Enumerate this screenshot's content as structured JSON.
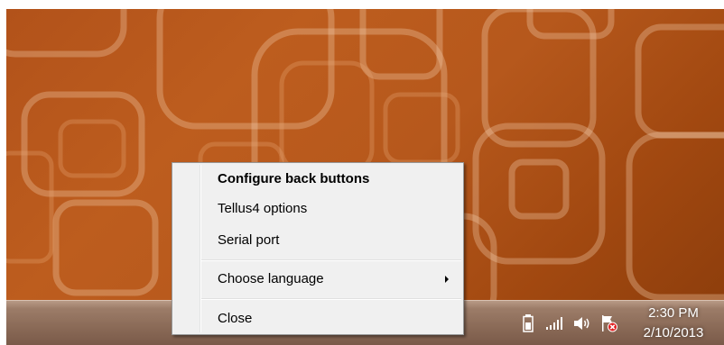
{
  "desktop": {
    "wallpaper": "orange-rounded-squares-wallpaper",
    "accent_color": "#b2521a"
  },
  "context_menu": {
    "items": [
      {
        "label": "Configure back buttons",
        "bold": true
      },
      {
        "label": "Tellus4 options",
        "bold": false
      },
      {
        "label": "Serial port",
        "bold": false
      },
      {
        "label": "Choose language",
        "bold": false,
        "has_submenu": true
      },
      {
        "label": "Close",
        "bold": false
      }
    ]
  },
  "taskbar": {
    "tray_icons": [
      "battery-icon",
      "signal-strength-icon",
      "speaker-volume-icon",
      "action-center-flag-icon"
    ],
    "clock": {
      "time": "2:30 PM",
      "date": "2/10/2013"
    }
  }
}
